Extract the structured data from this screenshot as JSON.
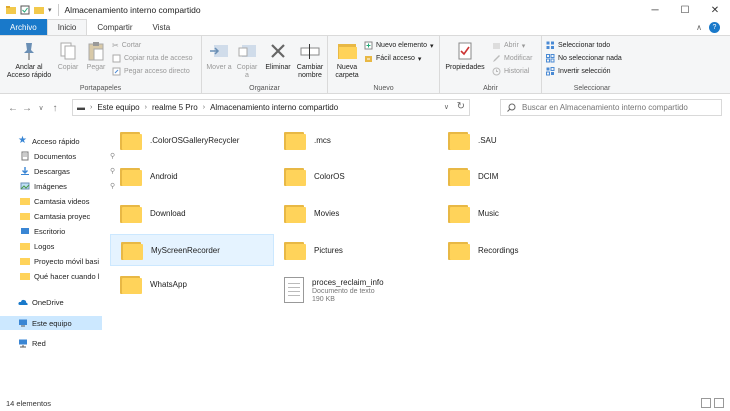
{
  "window": {
    "title": "Almacenamiento interno compartido"
  },
  "tabs": {
    "file": "Archivo",
    "home": "Inicio",
    "share": "Compartir",
    "view": "Vista"
  },
  "ribbon": {
    "portapapeles": {
      "label": "Portapapeles",
      "pin": "Anclar al Acceso rápido",
      "copy": "Copiar",
      "paste": "Pegar",
      "cut": "Cortar",
      "copy_path": "Copiar ruta de acceso",
      "paste_shortcut": "Pegar acceso directo"
    },
    "organizar": {
      "label": "Organizar",
      "move_to": "Mover a",
      "copy_to": "Copiar a",
      "delete": "Eliminar",
      "rename": "Cambiar nombre"
    },
    "nuevo": {
      "label": "Nuevo",
      "new_folder": "Nueva carpeta",
      "new_item": "Nuevo elemento",
      "easy_access": "Fácil acceso"
    },
    "abrir": {
      "label": "Abrir",
      "properties": "Propiedades",
      "open": "Abrir",
      "edit": "Modificar",
      "history": "Historial"
    },
    "seleccionar": {
      "label": "Seleccionar",
      "select_all": "Seleccionar todo",
      "select_none": "No seleccionar nada",
      "invert": "Invertir selección"
    }
  },
  "address": {
    "crumbs": [
      "Este equipo",
      "realme 5 Pro",
      "Almacenamiento interno compartido"
    ]
  },
  "search": {
    "placeholder": "Buscar en Almacenamiento interno compartido"
  },
  "nav": {
    "quick_access": "Acceso rápido",
    "documents": "Documentos",
    "downloads": "Descargas",
    "images": "Imágenes",
    "camtasia_videos": "Camtasia videos",
    "camtasia_proyec": "Camtasia proyec",
    "desktop": "Escritorio",
    "logos": "Logos",
    "proyecto_movil": "Proyecto móvil basi",
    "que_hacer": "Qué hacer cuando l",
    "onedrive": "OneDrive",
    "this_pc": "Este equipo",
    "network": "Red"
  },
  "items": [
    {
      "name": ".ColorOSGalleryRecycler"
    },
    {
      "name": ".mcs"
    },
    {
      "name": ".SAU"
    },
    {
      "name": "Android"
    },
    {
      "name": "ColorOS"
    },
    {
      "name": "DCIM"
    },
    {
      "name": "Download"
    },
    {
      "name": "Movies"
    },
    {
      "name": "Music"
    },
    {
      "name": "MyScreenRecorder"
    },
    {
      "name": "Pictures"
    },
    {
      "name": "Recordings"
    },
    {
      "name": "WhatsApp"
    },
    {
      "name": "proces_reclaim_info",
      "type": "Documento de texto",
      "size": "190 KB"
    }
  ],
  "status": {
    "count": "14 elementos"
  },
  "colors": {
    "accent": "#1979ca",
    "folder": "#ffd35a",
    "selection": "#cce8ff"
  }
}
